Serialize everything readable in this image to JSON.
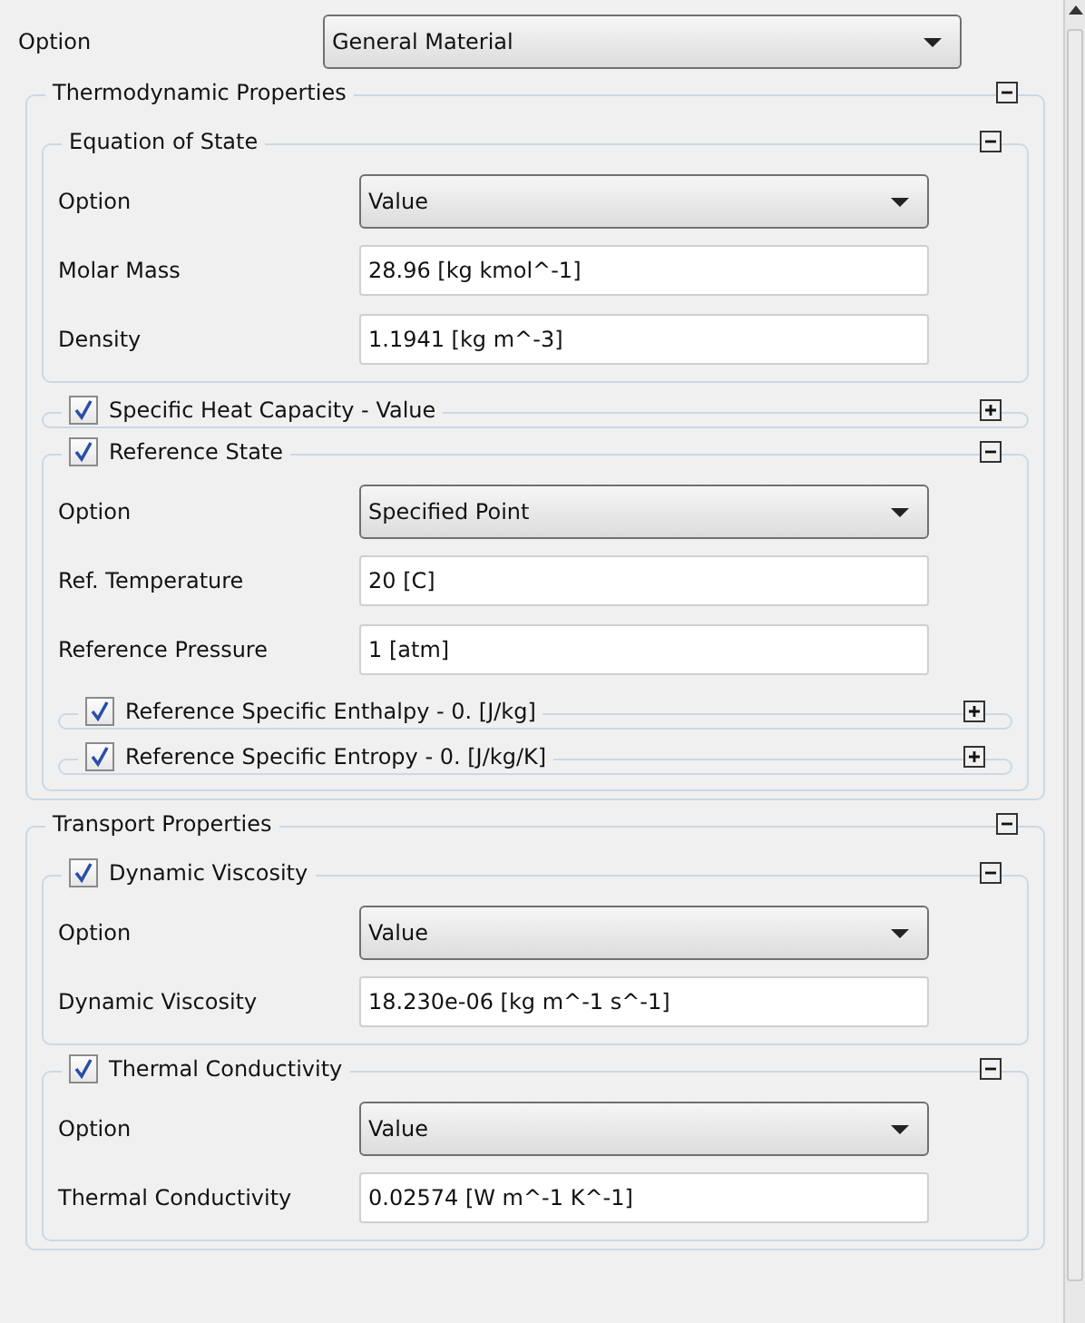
{
  "top_row": {
    "label": "Option",
    "kind": "select",
    "value": "General Material"
  },
  "groups": [
    {
      "title": "Thermodynamic Properties",
      "expanded": true,
      "children": [
        {
          "title": "Equation of State",
          "expanded": true,
          "rows": [
            {
              "label": "Option",
              "kind": "select",
              "value": "Value"
            },
            {
              "label": "Molar Mass",
              "kind": "field",
              "value": "28.96 [kg kmol^-1]"
            },
            {
              "label": "Density",
              "kind": "field",
              "value": "1.1941 [kg m^-3]"
            }
          ]
        },
        {
          "title": "Specific Heat Capacity - Value",
          "checked": true,
          "expanded": false
        },
        {
          "title": "Reference State",
          "checked": true,
          "expanded": true,
          "rows": [
            {
              "label": "Option",
              "kind": "select",
              "value": "Specified Point"
            },
            {
              "label": "Ref. Temperature",
              "kind": "field",
              "value": "20 [C]"
            },
            {
              "label": "Reference Pressure",
              "kind": "field",
              "value": "1 [atm]"
            }
          ],
          "children": [
            {
              "title": "Reference Specific Enthalpy - 0. [J/kg]",
              "checked": true,
              "expanded": false
            },
            {
              "title": "Reference Specific Entropy - 0. [J/kg/K]",
              "checked": true,
              "expanded": false
            }
          ]
        }
      ]
    },
    {
      "title": "Transport Properties",
      "expanded": true,
      "children": [
        {
          "title": "Dynamic Viscosity",
          "checked": true,
          "expanded": true,
          "rows": [
            {
              "label": "Option",
              "kind": "select",
              "value": "Value"
            },
            {
              "label": "Dynamic Viscosity",
              "kind": "field",
              "value": "18.230e-06 [kg m^-1 s^-1]"
            }
          ]
        },
        {
          "title": "Thermal Conductivity",
          "checked": true,
          "expanded": true,
          "rows": [
            {
              "label": "Option",
              "kind": "select",
              "value": "Value"
            },
            {
              "label": "Thermal Conductivity",
              "kind": "field",
              "value": "0.02574 [W m^-1 K^-1]"
            }
          ]
        }
      ]
    }
  ]
}
